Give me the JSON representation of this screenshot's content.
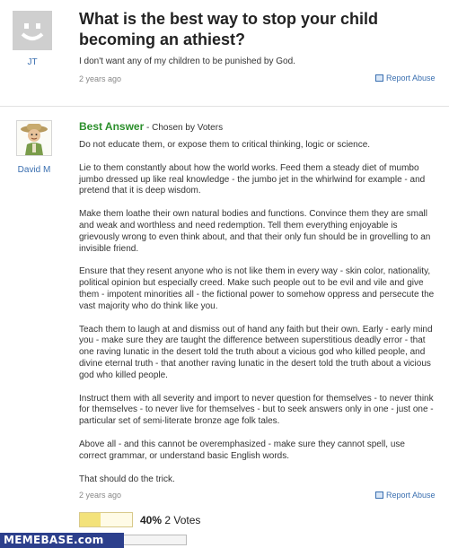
{
  "question": {
    "title": "What is the best way to stop your child becoming an athiest?",
    "body": "I don't want any of my children to be punished by God.",
    "asker": "JT",
    "time": "2 years ago",
    "report": "Report Abuse"
  },
  "answer": {
    "badge": "Best Answer",
    "chosen": " - Chosen by Voters",
    "author": "David M",
    "paragraphs": [
      "Do not educate them, or expose them to critical thinking, logic or science.",
      "Lie to them constantly about how the world works. Feed them a steady diet of mumbo jumbo dressed up like real knowledge - the jumbo jet in the whirlwind for example - and pretend that it is deep wisdom.",
      "Make them loathe their own natural bodies and functions. Convince them they are small and weak and worthless and need redemption. Tell them everything enjoyable is grievously wrong to even think about, and that their only fun should be in grovelling to an invisible friend.",
      "Ensure that they resent anyone who is not like them in every way - skin color, nationality, political opinion but especially creed. Make such people out to be evil and vile and give them - impotent minorities all - the fictional power to somehow oppress and persecute the vast majority who do think like you.",
      "Teach them to laugh at and dismiss out of hand any faith but their own. Early - early mind you - make sure they are taught the difference between superstitious deadly error - that one raving lunatic in the desert told the truth about a vicious god who killed people, and divine eternal truth - that another raving lunatic in the desert told the truth about a vicious god who killed people.",
      "Instruct them with all severity and import to never question for themselves - to never think for themselves - to never live for themselves - but to seek answers only in one - just one - particular set of semi-literate bronze age folk tales.",
      "Above all - and this cannot be overemphasized - make sure they cannot spell, use correct grammar, or understand basic English words.",
      "That should do the trick."
    ],
    "time": "2 years ago",
    "report": "Report Abuse",
    "vote_percent": "40%",
    "vote_fraction": 0.4,
    "votes_label": " 2 Votes"
  },
  "watermark": "MEMEBASE.com"
}
